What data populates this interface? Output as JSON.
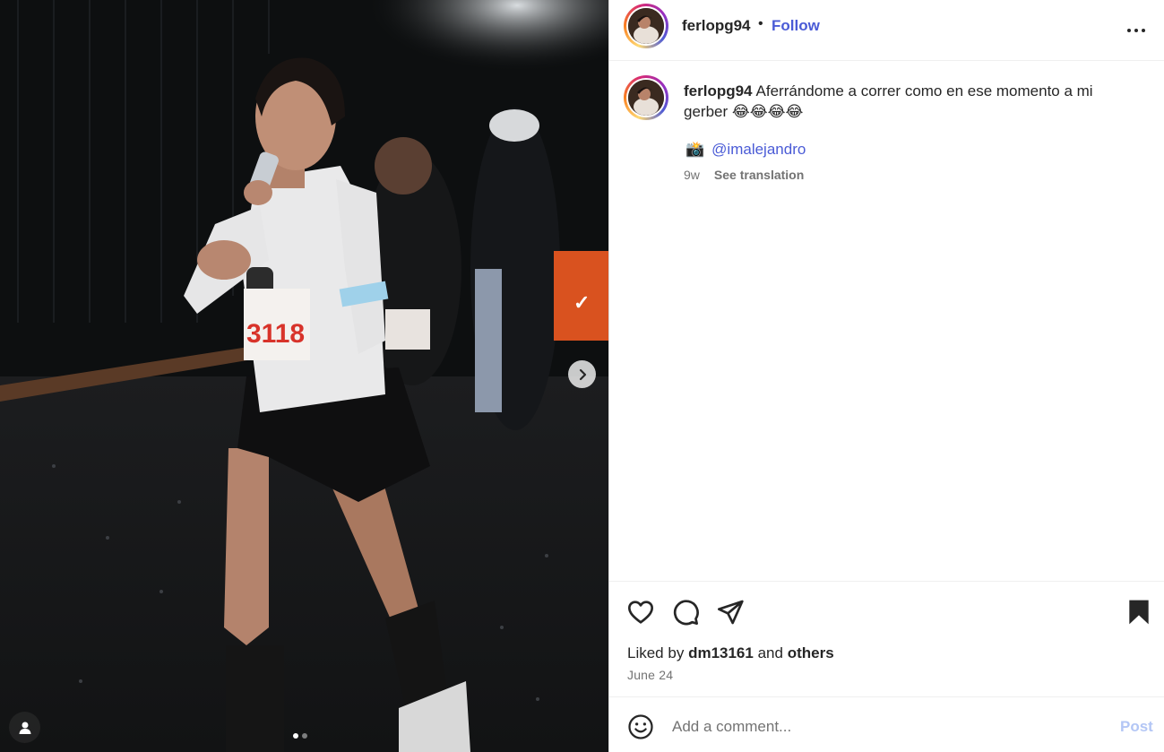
{
  "post": {
    "username": "ferlopg94",
    "separator": "•",
    "follow_label": "Follow",
    "caption_text": "Aferrándome a correr como en ese momento a mi gerber 😂😂😂😂",
    "credit_icon": "📸",
    "credit_mention": "@imalejandro",
    "time_ago": "9w",
    "see_translation": "See translation",
    "liked_prefix": "Liked by",
    "liked_user": "dm13161",
    "liked_and": "and",
    "liked_others": "others",
    "date": "June 24",
    "comment_placeholder": "Add a comment...",
    "post_label": "Post"
  },
  "media": {
    "bib_number": "3118",
    "carousel_count": 2,
    "carousel_active": 1
  },
  "icons": [
    "more-options-icon",
    "chevron-right-icon",
    "user-tag-icon",
    "heart-icon",
    "comment-icon",
    "share-icon",
    "bookmark-icon",
    "emoji-icon"
  ],
  "colors": {
    "link": "#4a5bd6",
    "post_disabled": "#b3c6f5",
    "muted": "#737373",
    "text": "#262626"
  }
}
